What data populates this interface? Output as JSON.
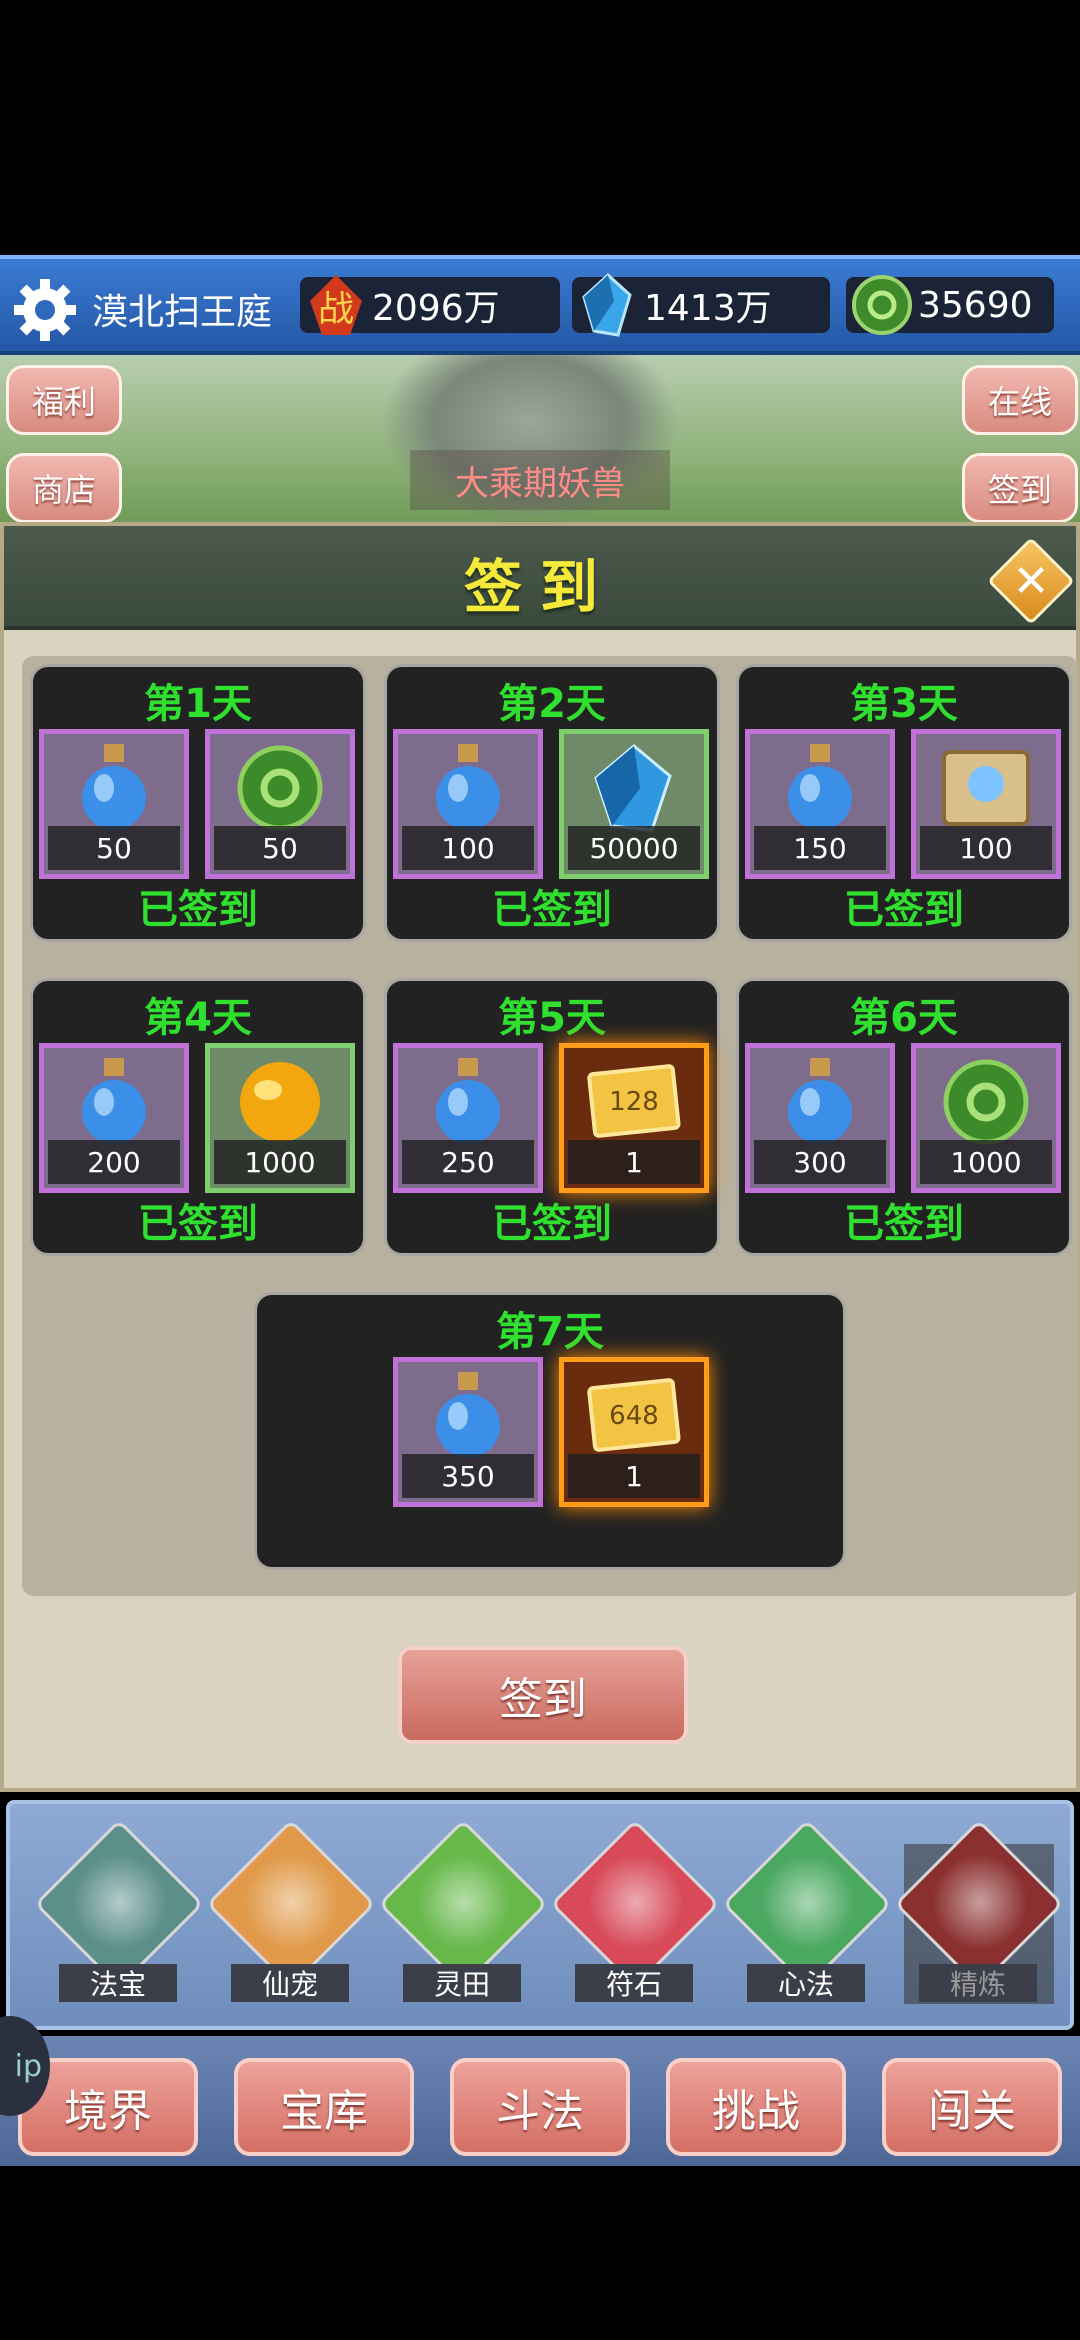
{
  "player": {
    "name": "漠北扫王庭"
  },
  "resources": {
    "power": {
      "icon": "battle-power-icon",
      "value": "2096万"
    },
    "crystal": {
      "icon": "crystal-icon",
      "value": "1413万"
    },
    "jade": {
      "icon": "jade-coin-icon",
      "value": "35690"
    }
  },
  "scene": {
    "left_buttons": [
      "福利",
      "商店"
    ],
    "right_buttons": [
      "在线",
      "签到"
    ],
    "boss_label": "大乘期妖兽"
  },
  "dialog": {
    "title": "签到",
    "close_symbol": "✕",
    "days": [
      {
        "title": "第1天",
        "status": "已签到",
        "items": [
          {
            "icon": "potion-icon",
            "count": "50",
            "frame": "purple"
          },
          {
            "icon": "jade-coin-icon",
            "count": "50",
            "frame": "purple"
          }
        ]
      },
      {
        "title": "第2天",
        "status": "已签到",
        "items": [
          {
            "icon": "potion-icon",
            "count": "100",
            "frame": "purple"
          },
          {
            "icon": "crystal-icon",
            "count": "50000",
            "frame": "green"
          }
        ]
      },
      {
        "title": "第3天",
        "status": "已签到",
        "items": [
          {
            "icon": "potion-icon",
            "count": "150",
            "frame": "purple"
          },
          {
            "icon": "scroll-icon",
            "count": "100",
            "frame": "purple"
          }
        ]
      },
      {
        "title": "第4天",
        "status": "已签到",
        "items": [
          {
            "icon": "potion-icon",
            "count": "200",
            "frame": "purple"
          },
          {
            "icon": "gold-orb-icon",
            "count": "1000",
            "frame": "green"
          }
        ]
      },
      {
        "title": "第5天",
        "status": "已签到",
        "items": [
          {
            "icon": "potion-icon",
            "count": "250",
            "frame": "purple"
          },
          {
            "icon": "ticket-icon",
            "ticket_value": "128",
            "count": "1",
            "frame": "gold"
          }
        ]
      },
      {
        "title": "第6天",
        "status": "已签到",
        "items": [
          {
            "icon": "potion-icon",
            "count": "300",
            "frame": "purple"
          },
          {
            "icon": "jade-coin-icon",
            "count": "1000",
            "frame": "purple"
          }
        ]
      },
      {
        "title": "第7天",
        "status": "",
        "items": [
          {
            "icon": "potion-icon",
            "count": "350",
            "frame": "purple"
          },
          {
            "icon": "ticket-icon",
            "ticket_value": "648",
            "count": "1",
            "frame": "gold"
          }
        ]
      }
    ],
    "sign_button": "签到"
  },
  "features": [
    {
      "label": "法宝",
      "icon": "treasure-icon",
      "locked": false
    },
    {
      "label": "仙宠",
      "icon": "pet-icon",
      "locked": false
    },
    {
      "label": "灵田",
      "icon": "field-icon",
      "locked": false
    },
    {
      "label": "符石",
      "icon": "rune-icon",
      "locked": false
    },
    {
      "label": "心法",
      "icon": "manual-icon",
      "locked": false,
      "badge": "心法"
    },
    {
      "label": "精炼",
      "icon": "lock-icon",
      "locked": true
    }
  ],
  "nav": [
    "境界",
    "宝库",
    "斗法",
    "挑战",
    "闯关"
  ],
  "float_ball_text": "ip"
}
